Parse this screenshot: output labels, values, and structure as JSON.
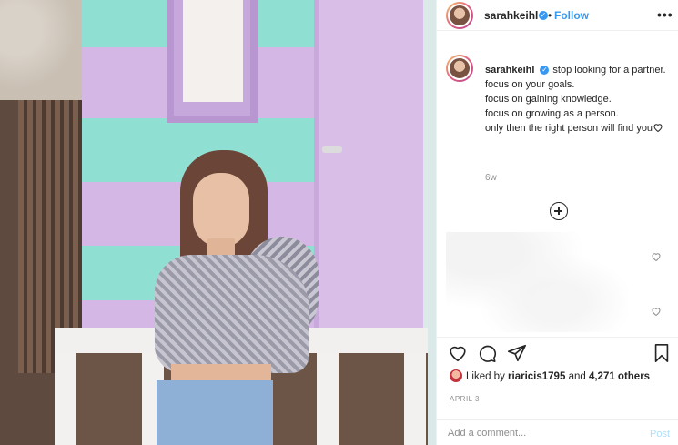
{
  "post": {
    "username": "sarahkeihl",
    "verified": true,
    "follow_separator": "•",
    "follow_label": "Follow",
    "more_label": "•••",
    "caption": {
      "username": "sarahkeihl",
      "lines": [
        "stop looking for a partner.",
        "focus on your goals.",
        "focus on gaining knowledge.",
        "focus on growing as a person.",
        "only then the right person will find you"
      ]
    },
    "time_ago": "6w",
    "likes": {
      "prefix": "Liked by",
      "first_user": "riaricis1795",
      "connector": "and",
      "others": "4,271 others"
    },
    "date": "APRIL 3",
    "comment": {
      "placeholder": "Add a comment...",
      "post_label": "Post"
    }
  },
  "icons": {
    "verified": "verified-badge-icon",
    "more": "more-options-icon",
    "load_more": "plus-circle-icon",
    "like": "heart-icon",
    "comment": "comment-icon",
    "share": "paper-plane-icon",
    "save": "bookmark-icon"
  },
  "colors": {
    "accent": "#3897f0",
    "text": "#262626",
    "muted": "#8e8e8e",
    "post_disabled": "#b2dffc"
  }
}
